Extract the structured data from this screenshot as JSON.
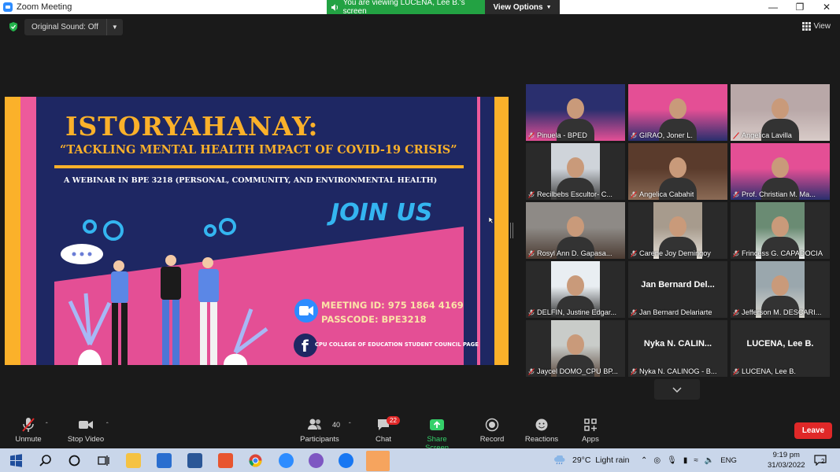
{
  "window": {
    "title": "Zoom Meeting"
  },
  "viewing": {
    "banner": "You are viewing LUCENA, Lee B.'s screen",
    "options": "View Options"
  },
  "topbar": {
    "original_sound": "Original Sound: Off",
    "view": "View"
  },
  "poster": {
    "title": "ISTORYAHANAY:",
    "subtitle": "“TACKLING MENTAL HEALTH IMPACT OF COVID-19 CRISIS”",
    "webinar": "A WEBINAR IN BPE 3218 (PERSONAL, COMMUNITY, AND ENVIRONMENTAL HEALTH)",
    "join": "JOIN US",
    "meeting_id": "MEETING ID: 975 1864 4169",
    "passcode": "PASSCODE: BPE3218",
    "fb_page": "CPU COLLEGE OF EDUCATION STUDENT COUNCIL PAGE"
  },
  "participants": [
    {
      "name": "Pinuela - BPED",
      "video": true,
      "active": true
    },
    {
      "name": "GIRAO, Joner L.",
      "video": true
    },
    {
      "name": "Angelica Lavilla",
      "video": true
    },
    {
      "name": "Recilbebs Escultor- C...",
      "video": true
    },
    {
      "name": "Angelica Cabahit",
      "video": true
    },
    {
      "name": "Prof. Christian M. Ma...",
      "video": true
    },
    {
      "name": "Rosyl Ann D. Gapasa...",
      "video": true
    },
    {
      "name": "Carene Joy Demingoy",
      "video": true
    },
    {
      "name": "Frincess G. CAPADOCIA",
      "video": true
    },
    {
      "name": "DELFIN, Justine Edgar...",
      "video": true
    },
    {
      "name": "Jan Bernard Delariarte",
      "video": false,
      "display": "Jan Bernard Del..."
    },
    {
      "name": "Jefferson M. DESCARI...",
      "video": true
    },
    {
      "name": "Jaycel DOMO_CPU BP...",
      "video": true
    },
    {
      "name": "Nyka N. CALINOG - B...",
      "video": false,
      "display": "Nyka N. CALIN..."
    },
    {
      "name": "LUCENA, Lee B.",
      "video": false,
      "display": "LUCENA, Lee B."
    }
  ],
  "toolbar": {
    "unmute": "Unmute",
    "stop_video": "Stop Video",
    "participants": "Participants",
    "participants_count": "40",
    "chat": "Chat",
    "chat_badge": "22",
    "share_screen": "Share Screen",
    "record": "Record",
    "reactions": "Reactions",
    "apps": "Apps",
    "leave": "Leave"
  },
  "taskbar": {
    "weather": "29°C  Light rain",
    "lang": "ENG",
    "time": "9:19 pm",
    "date": "31/03/2022",
    "notif_count": "2"
  },
  "colors": {
    "accent_green": "#23a243",
    "poster_yellow": "#fbb12a",
    "poster_pink": "#e44f95",
    "poster_navy": "#1e2763",
    "leave_red": "#e02828",
    "active_speaker": "#d7e842"
  }
}
